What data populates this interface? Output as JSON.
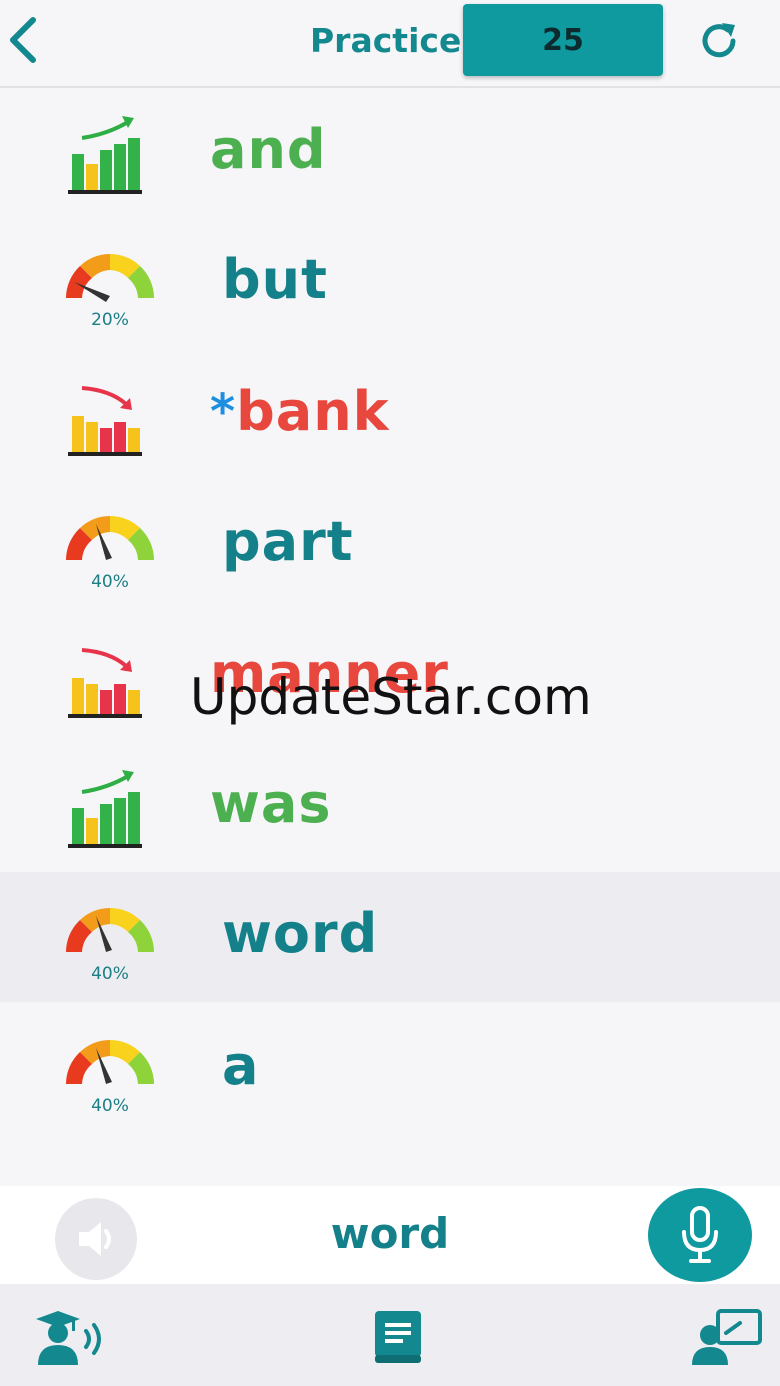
{
  "header": {
    "title": "Practice",
    "count": "25",
    "back_icon": "chevron-left-icon",
    "refresh_icon": "refresh-icon"
  },
  "words": [
    {
      "word": "and",
      "status": "rising",
      "color": "#4caf50"
    },
    {
      "word": "but",
      "status": "gauge",
      "percent": "20%",
      "color": "#14808a"
    },
    {
      "word": "bank",
      "status": "falling",
      "marked": true,
      "color": "#e8473e"
    },
    {
      "word": "part",
      "status": "gauge",
      "percent": "40%",
      "color": "#14808a"
    },
    {
      "word": "manner",
      "status": "falling",
      "color": "#e8473e"
    },
    {
      "word": "was",
      "status": "rising",
      "color": "#4caf50"
    },
    {
      "word": "word",
      "status": "gauge",
      "percent": "40%",
      "color": "#14808a",
      "selected": true
    },
    {
      "word": "a",
      "status": "gauge",
      "percent": "40%",
      "color": "#14808a"
    }
  ],
  "star": "*",
  "watermark": "UpdateStar.com",
  "current": {
    "word": "word",
    "speaker_icon": "speaker-icon",
    "mic_icon": "microphone-icon"
  },
  "nav": {
    "icons": [
      "student-speaking-icon",
      "book-icon",
      "teacher-board-icon"
    ]
  },
  "colors": {
    "accent": "#0f9aa0",
    "green": "#4caf50",
    "red": "#e8473e",
    "teal_text": "#14808a",
    "star_blue": "#1e8fe0"
  }
}
